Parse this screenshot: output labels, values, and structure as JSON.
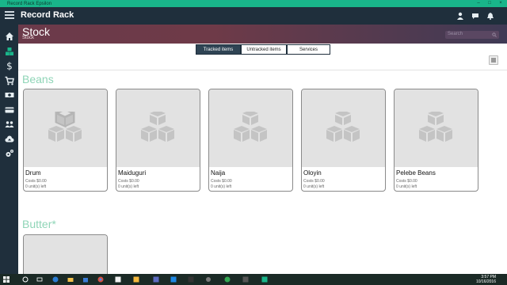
{
  "window": {
    "title": "Record Rack Epsilon"
  },
  "appbar": {
    "title": "Record Rack"
  },
  "header": {
    "title": "Stock",
    "subtitle": "Stock",
    "search_placeholder": "Search"
  },
  "tabs": [
    {
      "label": "Tracked items",
      "active": true
    },
    {
      "label": "Untracked items",
      "active": false
    },
    {
      "label": "Services",
      "active": false
    }
  ],
  "categories": [
    {
      "name": "Beans",
      "items": [
        {
          "name": "Drum",
          "cost": "Costs $0.00",
          "left": "0 unit(s) left"
        },
        {
          "name": "Maiduguri",
          "cost": "Costs $0.00",
          "left": "0 unit(s) left"
        },
        {
          "name": "Naija",
          "cost": "Costs $0.00",
          "left": "0 unit(s) left"
        },
        {
          "name": "Oloyin",
          "cost": "Costs $0.00",
          "left": "0 unit(s) left"
        },
        {
          "name": "Pelebe Beans",
          "cost": "Costs $0.00",
          "left": "0 unit(s) left"
        }
      ]
    },
    {
      "name": "Butter*",
      "items": []
    }
  ],
  "taskbar": {
    "time": "3:57 PM",
    "date": "10/16/2016"
  },
  "colors": {
    "accent": "#19b58a",
    "appbar": "#1f2f3c",
    "category": "#8fd5b7"
  }
}
